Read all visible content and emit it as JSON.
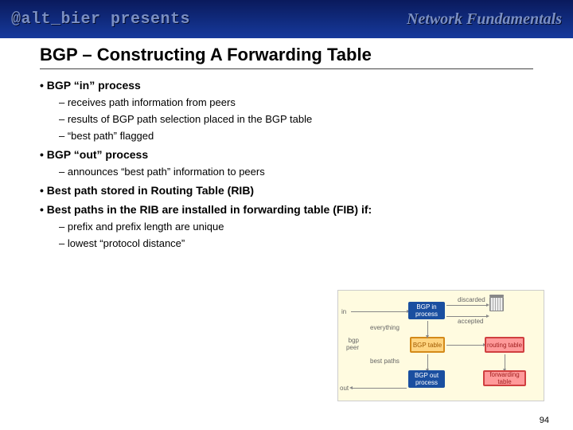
{
  "header": {
    "left": "@alt_bier presents",
    "right": "Network Fundamentals"
  },
  "title": "BGP – Constructing A Forwarding Table",
  "b1": "BGP “in” process",
  "b1s1": "receives path information from peers",
  "b1s2": "results of BGP path selection placed in the BGP table",
  "b1s3": "“best path” flagged",
  "b2": "BGP “out” process",
  "b2s1": "announces “best path” information to peers",
  "b3": "Best path stored in Routing Table (RIB)",
  "b4": "Best paths in the RIB are installed in forwarding table (FIB) if:",
  "b4s1": "prefix and prefix length are unique",
  "b4s2": "lowest “protocol distance”",
  "diagram": {
    "in": "in",
    "out": "out",
    "bgp_peer": "bgp peer",
    "everything": "everything",
    "best_paths": "best paths",
    "discarded": "discarded",
    "accepted": "accepted",
    "bgp_in": "BGP in process",
    "bgp_out": "BGP out process",
    "bgp_table": "BGP table",
    "routing_table": "routing table",
    "forwarding_table": "forwarding table"
  },
  "page": "94"
}
